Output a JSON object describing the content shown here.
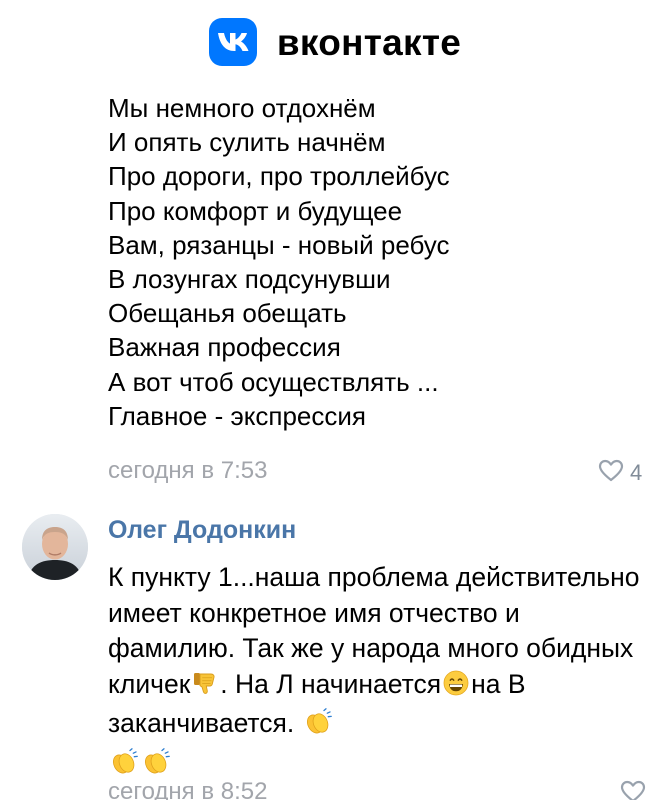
{
  "header": {
    "brand_name": "вконтакте",
    "logo_icon": "vk-logo-icon",
    "logo_color": "#0077ff"
  },
  "comments": [
    {
      "text_lines": [
        "Мы немного отдохнём",
        "И опять сулить начнём",
        "Про дороги, про троллейбус",
        "Про комфорт и будущее",
        "Вам, рязанцы - новый ребус",
        "В лозунгах подсунувши",
        "Обещанья обещать",
        "Важная профессия",
        "А вот чтоб осуществлять ...",
        "Главное - экспрессия"
      ],
      "time": "сегодня в 7:53",
      "likes": "4"
    },
    {
      "author": "Олег Додонкин",
      "text_parts": {
        "part1": "К пункту 1...наша проблема действительно имеет конкретное имя отчество и фамилию. Так же у народа много обидных кличек",
        "part2": ". На Л начинается",
        "part3": "на В заканчивается. "
      },
      "emoji_icons": [
        "thumbs-down-icon",
        "grinning-face-icon",
        "clapping-hands-icon",
        "clapping-hands-icon",
        "clapping-hands-icon"
      ],
      "time": "сегодня в 8:52",
      "likes": ""
    }
  ],
  "colors": {
    "meta_text": "#a2a5ab",
    "author_link": "#4a76a8"
  }
}
